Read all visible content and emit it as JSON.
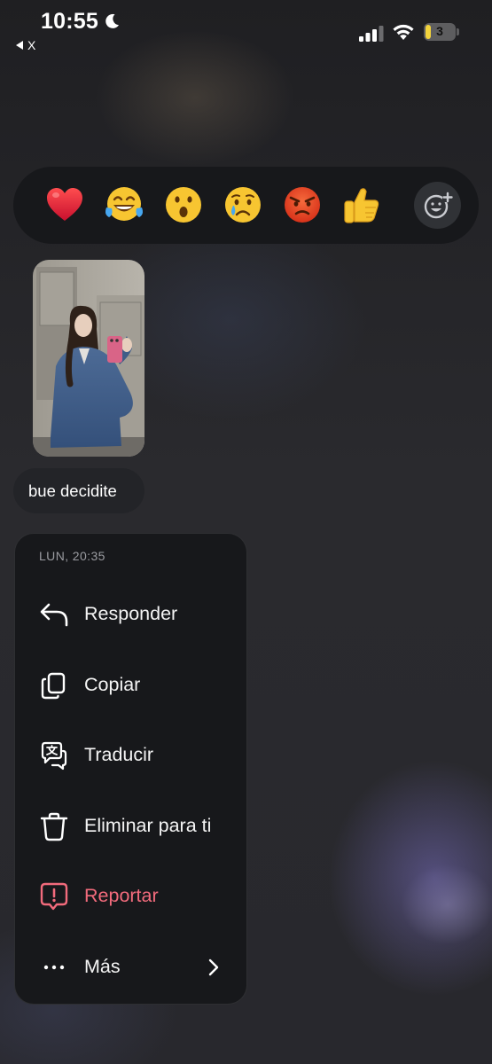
{
  "status_bar": {
    "time": "10:55",
    "back_app_label": "X",
    "battery_level": "3",
    "icons": [
      "moon-icon",
      "cellular-signal-icon",
      "wifi-icon",
      "battery-icon"
    ],
    "battery_fill_color": "#f2d33c"
  },
  "reactions": {
    "items": [
      {
        "name": "heart",
        "emoji": "❤️"
      },
      {
        "name": "joy",
        "emoji": "😂"
      },
      {
        "name": "surprised",
        "emoji": "😮"
      },
      {
        "name": "crying",
        "emoji": "😢"
      },
      {
        "name": "angry",
        "emoji": "😡"
      },
      {
        "name": "thumbs-up",
        "emoji": "👍"
      }
    ],
    "add_reaction_icon": "emoji-add-icon"
  },
  "message": {
    "photo_description_icon": "photo-thumbnail",
    "text": "bue decidite"
  },
  "menu": {
    "timestamp": "LUN, 20:35",
    "items": [
      {
        "label": "Responder",
        "icon": "reply-icon"
      },
      {
        "label": "Copiar",
        "icon": "copy-icon"
      },
      {
        "label": "Traducir",
        "icon": "translate-icon"
      },
      {
        "label": "Eliminar para ti",
        "icon": "trash-icon"
      },
      {
        "label": "Reportar",
        "icon": "report-icon"
      },
      {
        "label": "Más",
        "icon": "more-icon"
      }
    ],
    "danger_color": "#f26b7c"
  }
}
